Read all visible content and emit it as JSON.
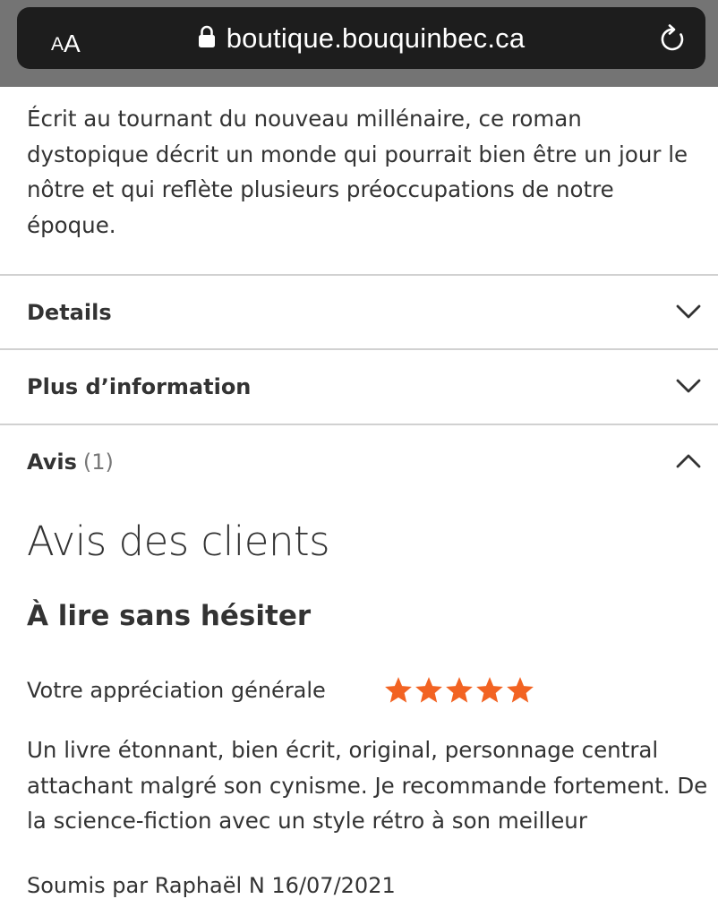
{
  "browser": {
    "aa_small": "A",
    "aa_big": "A",
    "url": "boutique.bouquinbec.ca",
    "icons": [
      "lock-icon",
      "reload-icon"
    ]
  },
  "product": {
    "description": "Écrit au tournant du nouveau millénaire, ce roman dystopique décrit un monde qui pourrait bien être un jour le nôtre et qui reflète plusieurs préoccupations de notre époque."
  },
  "sections": {
    "details": {
      "label": "Details",
      "state": "collapsed"
    },
    "more_info": {
      "label": "Plus d’information",
      "state": "collapsed"
    },
    "reviews": {
      "label": "Avis",
      "count": "(1)",
      "state": "expanded"
    }
  },
  "reviews": {
    "heading": "Avis des clients",
    "items": [
      {
        "title": "À lire sans hésiter",
        "rating_label": "Votre appréciation générale",
        "rating": 5,
        "rating_max": 5,
        "star_color": "#f26322",
        "body": "Un livre étonnant, bien écrit, original, personnage central attachant malgré son cynisme. Je recommande fortement. De la science-fiction avec un style rétro à son meilleur",
        "submitted": "Soumis par Raphaël N 16/07/2021"
      }
    ]
  }
}
